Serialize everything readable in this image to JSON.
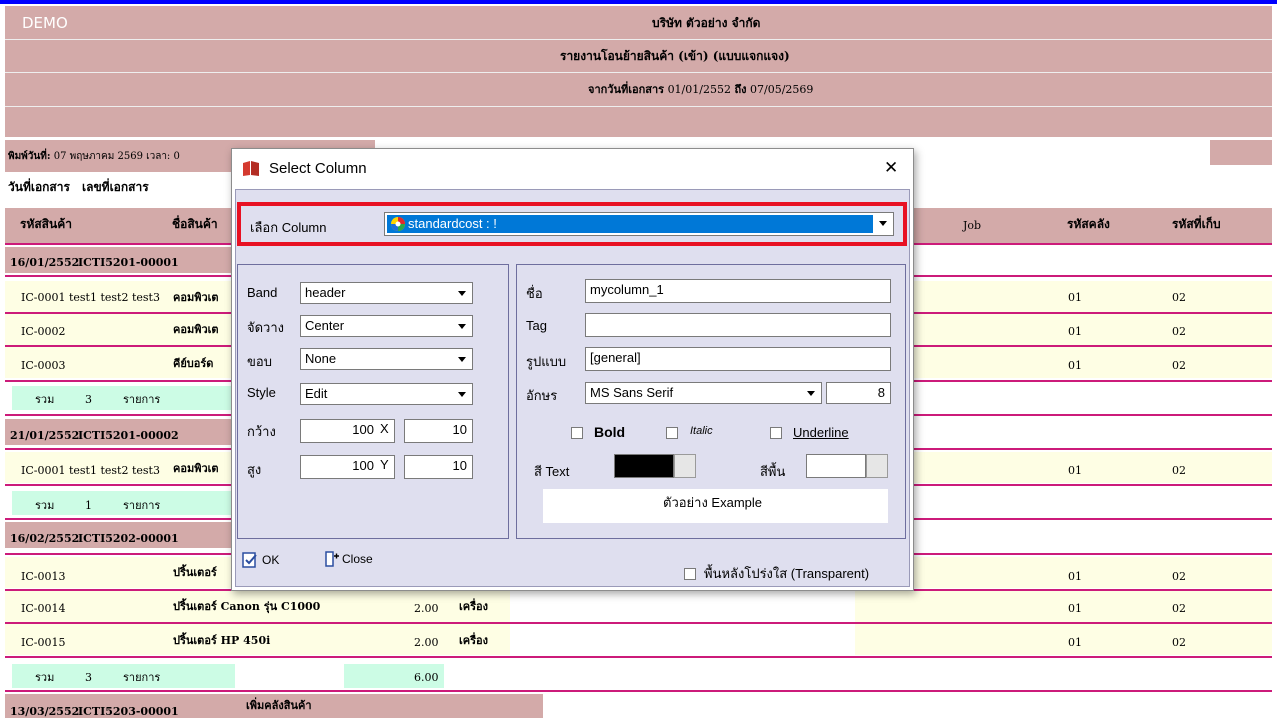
{
  "report": {
    "demo_label": "DEMO",
    "company": "บริษัท ตัวอย่าง จำกัด",
    "title": "รายงานโอนย้ายสินค้า (เข้า) (แบบแจกแจง)",
    "date_range_prefix": "จากวันที่เอกสาร",
    "date_from": "01/01/2552",
    "date_to_word": "ถึง",
    "date_to": "07/05/2569",
    "printed_prefix": "พิมพ์วันที่:",
    "printed_date": "07 พฤษภาคม 2569",
    "printed_time_prefix": "เวลา:",
    "printed_time_partial": "0",
    "columns_row1": {
      "doc_date": "วันที่เอกสาร",
      "doc_no": "เลขที่เอกสาร"
    },
    "columns_row2": {
      "product_code": "รหัสสินค้า",
      "product_name": "ชื่อสินค้า",
      "job": "Job",
      "warehouse": "รหัสคลัง",
      "location": "รหัสที่เก็บ"
    },
    "groups": [
      {
        "date": "16/01/2552",
        "doc": "ICTI5201-00001",
        "items": [
          {
            "code": "IC-0001 test1 test2 test3",
            "name": "คอมพิวเต",
            "qty": "",
            "unit": "",
            "wh": "01",
            "loc": "02"
          },
          {
            "code": "IC-0002",
            "name": "คอมพิวเต",
            "qty": "",
            "unit": "",
            "wh": "01",
            "loc": "02"
          },
          {
            "code": "IC-0003",
            "name": "คีย์บอร์ด",
            "qty": "",
            "unit": "",
            "wh": "01",
            "loc": "02"
          }
        ],
        "total": {
          "label": "รวม",
          "count": "3",
          "unit": "รายการ",
          "qty": ""
        }
      },
      {
        "date": "21/01/2552",
        "doc": "ICTI5201-00002",
        "items": [
          {
            "code": "IC-0001 test1 test2 test3",
            "name": "คอมพิวเต",
            "qty": "",
            "unit": "",
            "wh": "01",
            "loc": "02"
          }
        ],
        "total": {
          "label": "รวม",
          "count": "1",
          "unit": "รายการ",
          "qty": ""
        }
      },
      {
        "date": "16/02/2552",
        "doc": "ICTI5202-00001",
        "items": [
          {
            "code": "IC-0013",
            "name": "ปริ้นเตอร์",
            "qty": "",
            "unit": "",
            "wh": "01",
            "loc": "02"
          },
          {
            "code": "IC-0014",
            "name": "ปริ้นเตอร์ Canon รุ่น C1000",
            "qty": "2.00",
            "unit": "เครื่อง",
            "wh": "01",
            "loc": "02"
          },
          {
            "code": "IC-0015",
            "name": "ปริ้นเตอร์ HP 450i",
            "qty": "2.00",
            "unit": "เครื่อง",
            "wh": "01",
            "loc": "02"
          }
        ],
        "total": {
          "label": "รวม",
          "count": "3",
          "unit": "รายการ",
          "qty": "6.00"
        }
      }
    ],
    "last_group": {
      "date": "13/03/2552",
      "doc": "ICTI5203-00001",
      "note": "เพิ่มคลังสินค้า"
    }
  },
  "dialog": {
    "title": "Select Column",
    "close_glyph": "✕",
    "select_column_label": "เลือก Column",
    "select_column_value": "standardcost : !",
    "band_label": "Band",
    "band_value": "header",
    "align_label": "จัดวาง",
    "align_value": "Center",
    "border_label": "ขอบ",
    "border_value": "None",
    "style_label": "Style",
    "style_value": "Edit",
    "width_label": "กว้าง",
    "width_value": "100",
    "x_label": "X",
    "x_value": "10",
    "height_label": "สูง",
    "height_value": "100",
    "y_label": "Y",
    "y_value": "10",
    "name_label": "ชื่อ",
    "name_value": "mycolumn_1",
    "tag_label": "Tag",
    "tag_value": "",
    "format_label": "รูปแบบ",
    "format_value": "[general]",
    "font_label": "อักษร",
    "font_value": "MS Sans Serif",
    "font_size": "8",
    "bold_label": "Bold",
    "italic_label": "Italic",
    "underline_label": "Underline",
    "text_color_label": "สี Text",
    "bg_color_label": "สีพื้น",
    "sample_text": "ตัวอย่าง Example",
    "ok_label": "OK",
    "close_label": "Close",
    "transparent_label": "พื้นหลังโปร่งใส (Transparent)",
    "colors": {
      "text_color": "#000000",
      "bg_color": "#ffffff",
      "selection": "#0078d7",
      "highlight_box": "#e81123"
    }
  }
}
